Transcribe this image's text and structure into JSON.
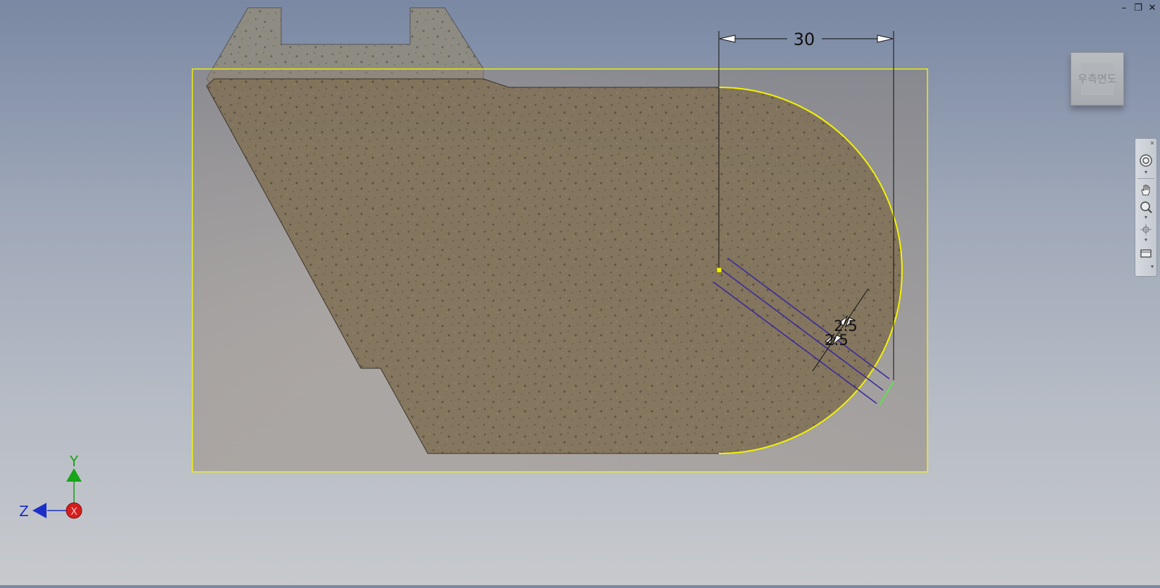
{
  "window_controls": {
    "minimize": "–",
    "restore": "❐",
    "close": "✕"
  },
  "dimensions": {
    "horizontal": "30",
    "offset_1": "2.5",
    "offset_2": "2.5"
  },
  "view_cube": {
    "face_label": "우측면도"
  },
  "axis_triad": {
    "y_label": "Y",
    "z_label": "Z",
    "x_label": "X"
  },
  "nav_bar": {
    "tools": [
      "steering-wheel",
      "pan",
      "zoom",
      "orbit",
      "look-at"
    ]
  },
  "colors": {
    "sketch_highlight": "#f3f300",
    "construction_line": "#3b2a9a",
    "constraint_green": "#5ee04a",
    "dimension": "#101010",
    "part_fill": "#7c6e56",
    "axis_y": "#19a419",
    "axis_z": "#1b2fc8",
    "axis_x": "#d41e1e"
  }
}
